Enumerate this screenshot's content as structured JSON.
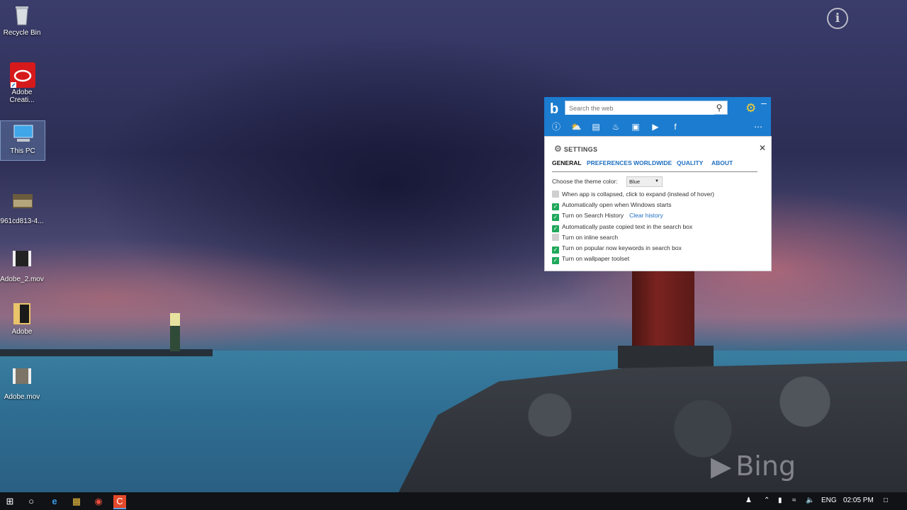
{
  "desktop": {
    "icons": [
      {
        "label": "Recycle Bin",
        "icon": "recycle-bin-icon"
      },
      {
        "label": "Adobe Creati...",
        "icon": "adobe-cc-icon"
      },
      {
        "label": "This PC",
        "icon": "computer-icon"
      },
      {
        "label": "961cd813-4...",
        "icon": "image-file-icon"
      },
      {
        "label": "Adobe_2.mov",
        "icon": "video-file-icon"
      },
      {
        "label": "Adobe",
        "icon": "folder-icon"
      },
      {
        "label": "Adobe.mov",
        "icon": "video-file-icon"
      }
    ],
    "watermark": "Bing"
  },
  "bing_app": {
    "search_placeholder": "Search the web",
    "toolbar_icons": [
      "info-icon",
      "weather-icon",
      "news-icon",
      "trending-icon",
      "images-icon",
      "videos-icon",
      "facebook-icon",
      "more-icon"
    ]
  },
  "settings": {
    "title": "SETTINGS",
    "tabs": [
      "GENERAL",
      "PREFERENCES",
      "WORLDWIDE",
      "QUALITY",
      "ABOUT"
    ],
    "active_tab": "GENERAL",
    "theme_label": "Choose the theme color:",
    "theme_value": "Blue",
    "options": [
      {
        "label": "When app is collapsed, click to expand (instead of hover)",
        "checked": false
      },
      {
        "label": "Automatically open when Windows starts",
        "checked": true
      },
      {
        "label": "Turn on Search History",
        "checked": true,
        "link": "Clear history"
      },
      {
        "label": "Automatically paste copied text in the search box",
        "checked": true
      },
      {
        "label": "Turn on inline search",
        "checked": false
      },
      {
        "label": "Turn on popular now keywords in search box",
        "checked": true
      },
      {
        "label": "Turn on wallpaper toolset",
        "checked": true
      }
    ]
  },
  "taskbar": {
    "language": "ENG",
    "time": "02:05 PM"
  },
  "colors": {
    "bing_blue": "#1b7cd0",
    "check_green": "#1fa85a",
    "link_blue": "#1e6fc0",
    "gear_yellow": "#f5d033"
  }
}
